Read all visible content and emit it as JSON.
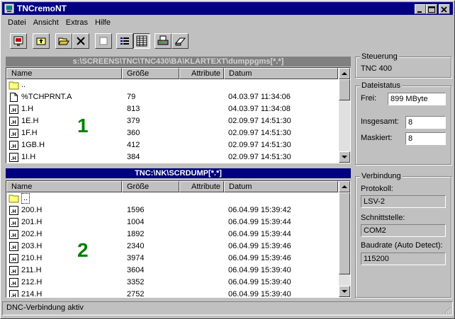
{
  "window": {
    "title": "TNCremoNT"
  },
  "menu": [
    "Datei",
    "Ansicht",
    "Extras",
    "Hilfe"
  ],
  "panel1": {
    "path": "s:\\SCREENS\\TNC\\TNC430\\BA\\KLARTEXT\\dumppgms[*.*]",
    "columns": [
      "Name",
      "Größe",
      "Attribute",
      "Datum"
    ],
    "number": "1",
    "rows": [
      {
        "type": "folder",
        "name": "..",
        "size": "",
        "date": ""
      },
      {
        "type": "file",
        "name": "%TCHPRNT.A",
        "size": "79",
        "date": "04.03.97 11:34:06"
      },
      {
        "type": "h",
        "name": "1.H",
        "size": "813",
        "date": "04.03.97 11:34:08"
      },
      {
        "type": "h",
        "name": "1E.H",
        "size": "379",
        "date": "02.09.97 14:51:30"
      },
      {
        "type": "h",
        "name": "1F.H",
        "size": "360",
        "date": "02.09.97 14:51:30"
      },
      {
        "type": "h",
        "name": "1GB.H",
        "size": "412",
        "date": "02.09.97 14:51:30"
      },
      {
        "type": "h",
        "name": "1I.H",
        "size": "384",
        "date": "02.09.97 14:51:30"
      }
    ]
  },
  "panel2": {
    "path": "TNC:\\NK\\SCRDUMP[*.*]",
    "columns": [
      "Name",
      "Größe",
      "Attribute",
      "Datum"
    ],
    "number": "2",
    "rows": [
      {
        "type": "folder",
        "name": "..",
        "size": "",
        "date": ""
      },
      {
        "type": "h",
        "name": "200.H",
        "size": "1596",
        "date": "06.04.99 15:39:42"
      },
      {
        "type": "h",
        "name": "201.H",
        "size": "1004",
        "date": "06.04.99 15:39:44"
      },
      {
        "type": "h",
        "name": "202.H",
        "size": "1892",
        "date": "06.04.99 15:39:44"
      },
      {
        "type": "h",
        "name": "203.H",
        "size": "2340",
        "date": "06.04.99 15:39:46"
      },
      {
        "type": "h",
        "name": "210.H",
        "size": "3974",
        "date": "06.04.99 15:39:46"
      },
      {
        "type": "h",
        "name": "211.H",
        "size": "3604",
        "date": "06.04.99 15:39:40"
      },
      {
        "type": "h",
        "name": "212.H",
        "size": "3352",
        "date": "06.04.99 15:39:40"
      },
      {
        "type": "h",
        "name": "214.H",
        "size": "2752",
        "date": "06.04.99 15:39:40"
      }
    ]
  },
  "steuerung": {
    "title": "Steuerung",
    "value": "TNC 400"
  },
  "dateistatus": {
    "title": "Dateistatus",
    "frei_label": "Frei:",
    "frei_value": "899 MByte",
    "insgesamt_label": "Insgesamt:",
    "insgesamt_value": "8",
    "maskiert_label": "Maskiert:",
    "maskiert_value": "8"
  },
  "verbindung": {
    "title": "Verbindung",
    "protokoll_label": "Protokoll:",
    "protokoll_value": "LSV-2",
    "schnittstelle_label": "Schnittstelle:",
    "schnittstelle_value": "COM2",
    "baudrate_label": "Baudrate (Auto Detect):",
    "baudrate_value": "115200"
  },
  "status": {
    "text": "DNC-Verbindung aktiv"
  }
}
